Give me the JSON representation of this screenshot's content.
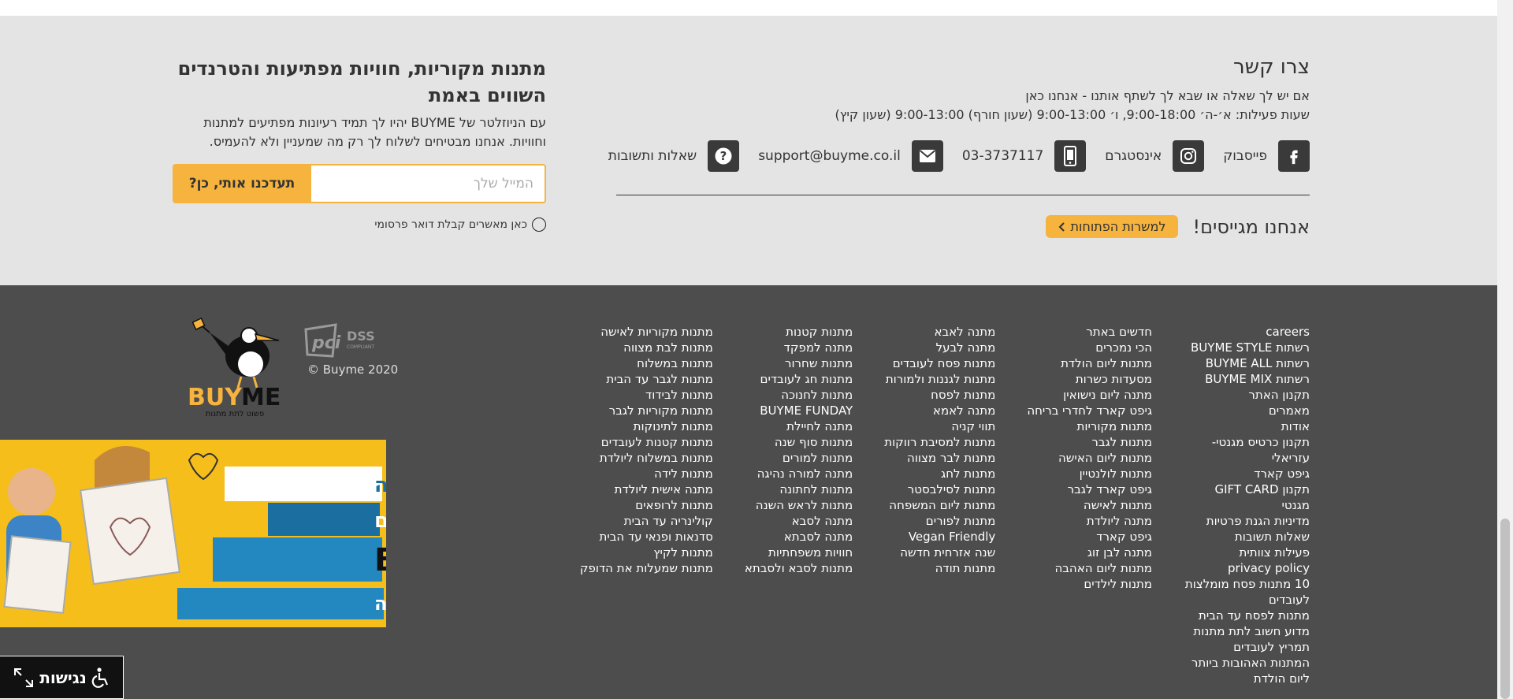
{
  "contact": {
    "title": "צרו קשר",
    "line1": "אם יש לך שאלה או שבא לך לשתף אותנו - אנחנו כאן",
    "line2": "שעות פעילות: א׳-ה׳ 9:00-18:00, ו׳ 9:00-13:00 (שעון חורף) 9:00-13:00 (שעון קיץ)",
    "items": [
      {
        "icon": "facebook-icon",
        "label": "פייסבוק"
      },
      {
        "icon": "instagram-icon",
        "label": "אינסטגרם"
      },
      {
        "icon": "phone-icon",
        "label": "03-3737117"
      },
      {
        "icon": "mail-icon",
        "label": "support@buyme.co.il"
      },
      {
        "icon": "question-icon",
        "label": "שאלות ותשובות"
      }
    ],
    "growing_title": "אנחנו מגייסים!",
    "growing_button": "למשרות הפתוחות"
  },
  "newsletter": {
    "title": "מתנות מקוריות, חוויות מפתיעות והטרנדים השווים באמת",
    "description": "עם הניוזלטר של BUYME יהיו לך תמיד רעיונות מפתיעים למתנות וחוויות. אנחנו מבטיחים לשלוח לך רק מה שמעניין ולא להעמיס.",
    "email_placeholder": "המייל שלך",
    "submit_label": "תעדכנו אותי, כן?",
    "consent_label": "כאן מאשרים קבלת דואר פרסומי"
  },
  "footer": {
    "columns": [
      [
        "careers",
        "רשתות BUYME STYLE",
        "רשתות BUYME ALL",
        "רשתות BUYME MIX",
        "תקנון האתר",
        "מאמרים",
        "אודות",
        "תקנון כרטיס מגנטי- עזריאלי",
        "גיפט קארד",
        "תקנון GIFT CARD מגנטי",
        "מדיניות הגנת פרטיות",
        "שאלות תשובות",
        "פעילות צוותית",
        "privacy policy",
        "10 מתנות פסח מומלצות לעובדים",
        "מתנות לפסח עד הבית",
        "מדוע חשוב לתת מתנות",
        "תמריץ לעובדים",
        "המתנות האהובות ביותר ליום הולדת"
      ],
      [
        "חדשים באתר",
        "הכי נמכרים",
        "מתנות ליום הולדת",
        "מסעדות כשרות",
        "מתנה ליום נישואין",
        "גיפט קארד לחדרי בריחה",
        "מתנות מקוריות",
        "מתנות לגבר",
        "מתנות ליום האישה",
        "מתנות לולנטיין",
        "גיפט קארד לגבר",
        "מתנות לאישה",
        "מתנה ליולדת",
        "גיפט קארד",
        "מתנה לבן זוג",
        "מתנות ליום האהבה",
        "מתנות לילדים"
      ],
      [
        "מתנה לאבא",
        "מתנה לבעל",
        "מתנות פסח לעובדים",
        "מתנות לגננות ולמורות",
        "מתנות לפסח",
        "מתנה לאמא",
        "תווי קניה",
        "מתנות למסיבת רווקות",
        "מתנות לבר מצווה",
        "מתנות לחג",
        "מתנות לסילבסטר",
        "מתנות ליום המשפחה",
        "מתנות לפורים",
        "Vegan Friendly",
        "שנה אזרחית חדשה",
        "מתנות תודה"
      ],
      [
        "מתנות קטנות",
        "מתנה למפקד",
        "מתנות שחרור",
        "מתנות חג לעובדים",
        "מתנות לחנוכה",
        "BUYME FUNDAY",
        "מתנה לחיילת",
        "מתנות סוף שנה",
        "מתנות למורים",
        "מתנה למורה נהיגה",
        "מתנות לחתונה",
        "מתנות לראש השנה",
        "מתנה לסבא",
        "מתנה לסבתא",
        "חוויות משפחתיות",
        "מתנות לסבא ולסבתא"
      ],
      [
        "מתנות מקוריות לאישה",
        "מתנות לבת מצווה",
        "מתנות במשלוח",
        "מתנות לגבר עד הבית",
        "מתנות לבידוד",
        "מתנות מקוריות לגבר",
        "מתנות לתינוקות",
        "מתנות קטנות לעובדים",
        "מתנות במשלוח ליולדת",
        "מתנות לידה",
        "מתנה אישית ליולדת",
        "מתנות לרופאים",
        "קולינריה עד הבית",
        "סדנאות ופנאי עד הבית",
        "מתנות לקיץ",
        "מתנות שמעלות את הדופק"
      ]
    ],
    "copyright": "© Buyme 2020",
    "logo_text": "BUYME",
    "logo_slogan": "פשוט לתת מתנות",
    "pci_text": "PCI DSS",
    "promo": {
      "line1": "אומרים תודה",
      "line2": "ושולחים",
      "line3": "BUYME",
      "line4": "למתנות סוף השנה"
    }
  },
  "accessibility": {
    "label": "נגישות"
  },
  "colors": {
    "accent": "#f6b33d",
    "footer_bg": "#4d4d4d",
    "contact_bg": "#e4e4e4"
  }
}
